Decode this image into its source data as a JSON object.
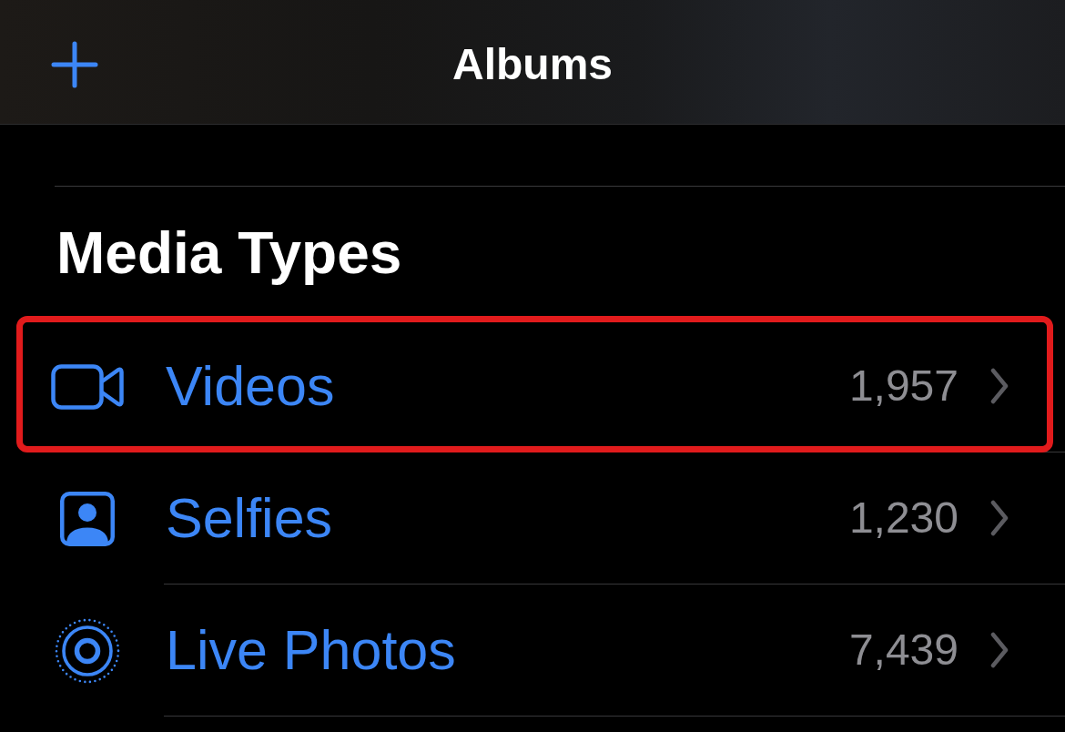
{
  "navigation_bar": {
    "title": "Albums"
  },
  "media_types": {
    "heading": "Media Types",
    "rows": [
      {
        "kind": "video",
        "label": "Videos",
        "count": "1,957",
        "highlighted": true
      },
      {
        "kind": "selfie",
        "label": "Selfies",
        "count": "1,230",
        "highlighted": false
      },
      {
        "kind": "live",
        "label": "Live Photos",
        "count": "7,439",
        "highlighted": false
      }
    ]
  }
}
